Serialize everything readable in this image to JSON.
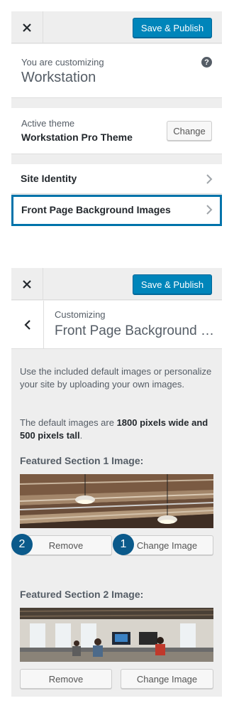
{
  "panel1": {
    "publish_label": "Save & Publish",
    "info_small": "You are customizing",
    "info_big": "Workstation",
    "help_glyph": "?",
    "theme_label": "Active theme",
    "theme_name": "Workstation Pro Theme",
    "change_label": "Change",
    "sections": [
      {
        "label": "Site Identity"
      },
      {
        "label": "Front Page Background Images"
      }
    ]
  },
  "panel2": {
    "publish_label": "Save & Publish",
    "customizing_label": "Customizing",
    "section_title": "Front Page Background Images",
    "desc1": "Use the included default images or personalize your site by uploading your own images.",
    "desc2_prefix": "The default images are ",
    "desc2_bold": "1800 pixels wide and 500 pixels tall",
    "desc2_suffix": ".",
    "fields": [
      {
        "title": "Featured Section 1 Image:",
        "remove_label": "Remove",
        "change_label": "Change Image",
        "image": "ceiling-lights-photo"
      },
      {
        "title": "Featured Section 2 Image:",
        "remove_label": "Remove",
        "change_label": "Change Image",
        "image": "office-workspace-photo"
      }
    ],
    "callouts": [
      "2",
      "1"
    ]
  },
  "colors": {
    "accent": "#0085ba",
    "highlight_border": "#0073aa",
    "callout": "#0b5a8b",
    "panel_bg": "#eeeeee"
  }
}
